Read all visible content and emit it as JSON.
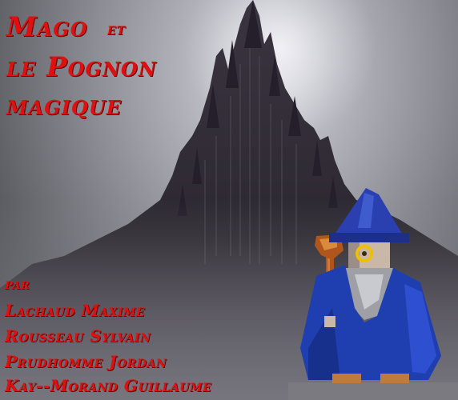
{
  "title": {
    "line1_main": "Mago",
    "line1_small": "et",
    "line2": "le Pognon",
    "line3": "magique"
  },
  "credits": {
    "intro": "par",
    "authors": [
      "Lachaud Maxime",
      "Rousseau Sylvain",
      "Prudhomme Jordan",
      "Kay--Morand Guillaume"
    ]
  },
  "colors": {
    "title": "#e01010",
    "wizard_robe": "#1f3fb0",
    "staff": "#b0561c",
    "monocle": "#f0c000"
  },
  "icons": {
    "background": "dark-castle-mountain",
    "character": "wizard-sprite"
  }
}
